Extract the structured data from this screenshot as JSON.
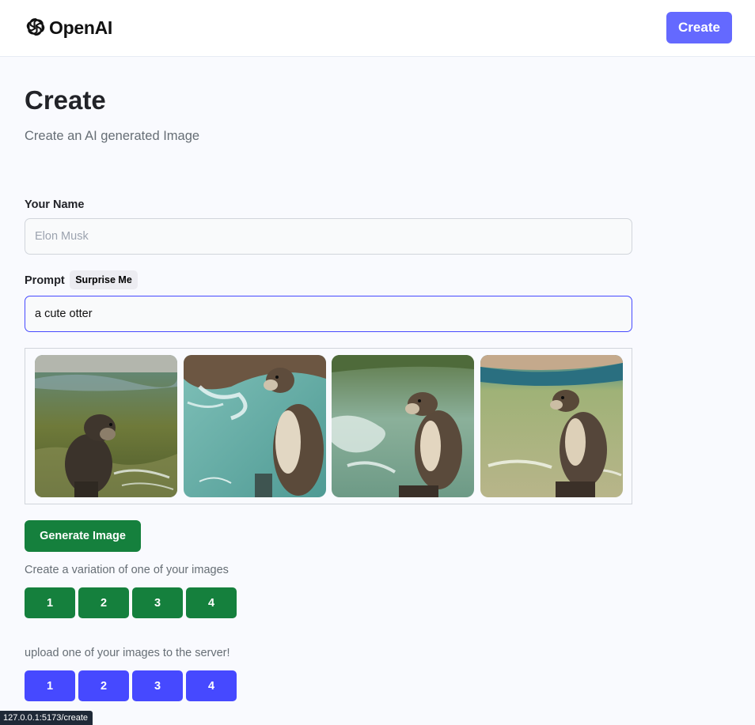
{
  "header": {
    "logo_text": "OpenAI",
    "create_label": "Create"
  },
  "main": {
    "title": "Create",
    "subtitle": "Create an AI generated Image"
  },
  "form": {
    "name_label": "Your Name",
    "name_placeholder": "Elon Musk",
    "prompt_label": "Prompt",
    "surprise_label": "Surprise Me",
    "prompt_value": "a cute otter"
  },
  "gallery": {
    "images": [
      {
        "subject": "otter-in-water"
      },
      {
        "subject": "otter-by-splashing-water"
      },
      {
        "subject": "otter-in-pool"
      },
      {
        "subject": "otter-in-pond"
      }
    ]
  },
  "actions": {
    "generate_label": "Generate Image",
    "variation_note": "Create a variation of one of your images",
    "variation_buttons": [
      "1",
      "2",
      "3",
      "4"
    ],
    "upload_note": "upload one of your images to the server!",
    "upload_buttons": [
      "1",
      "2",
      "3",
      "4"
    ]
  },
  "status_bar": {
    "url": "127.0.0.1:5173/create"
  },
  "colors": {
    "accent": "#6469ff",
    "green": "#15803d",
    "blue": "#4649ff",
    "background": "#f9fafe"
  }
}
